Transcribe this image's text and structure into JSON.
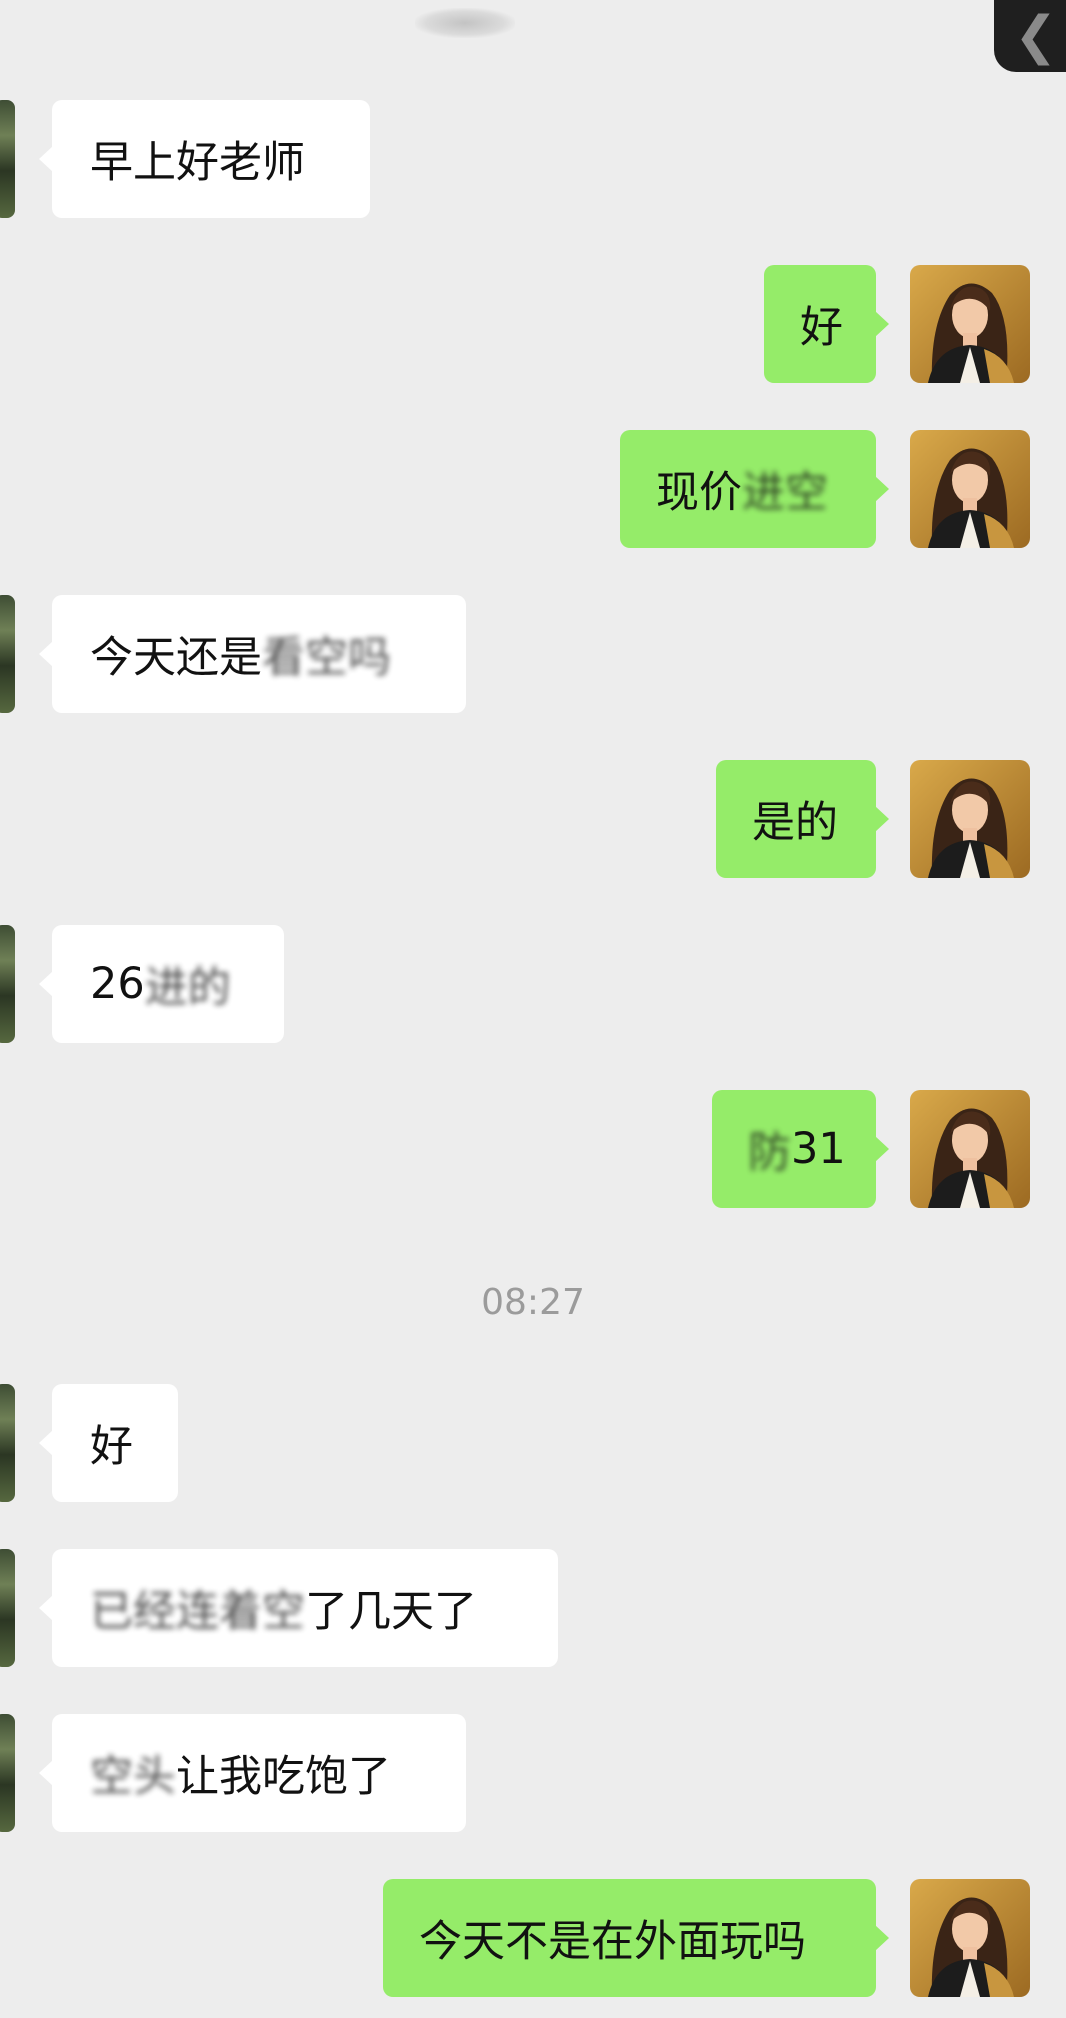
{
  "header": {
    "back_icon": "chevron-left-icon",
    "back_glyph": "❮"
  },
  "colors": {
    "background": "#ededed",
    "incoming_bubble": "#ffffff",
    "outgoing_bubble": "#95ec69",
    "timestamp_text": "#9b9b9b"
  },
  "messages": [
    {
      "side": "in",
      "text": "早上好老师",
      "clear": "早上好老师",
      "blurred": ""
    },
    {
      "side": "out",
      "text": "好",
      "clear": "好",
      "blurred": ""
    },
    {
      "side": "out",
      "text": "现价进空",
      "clear": "现价",
      "blurred": "进空"
    },
    {
      "side": "in",
      "text": "今天还是看空吗",
      "clear": "今天还是",
      "blurred": "看空吗"
    },
    {
      "side": "out",
      "text": "是的",
      "clear": "是的",
      "blurred": ""
    },
    {
      "side": "in",
      "text": "26进的",
      "clear": "26",
      "blurred": "进的"
    },
    {
      "side": "out",
      "text": "防31",
      "clear": "31",
      "blurred": "防"
    },
    {
      "side": "in",
      "text": "好",
      "clear": "好",
      "blurred": ""
    },
    {
      "side": "in",
      "text": "已经连着空了几天了",
      "clear": "了几天了",
      "blurred": "已经连着空"
    },
    {
      "side": "in",
      "text": "空头让我吃饱了",
      "clear": "让我吃饱了",
      "blurred": "空头"
    },
    {
      "side": "out",
      "text": "今天不是在外面玩吗",
      "clear": "今天不是在外面玩吗",
      "blurred": ""
    }
  ],
  "timestamp": "08:27"
}
